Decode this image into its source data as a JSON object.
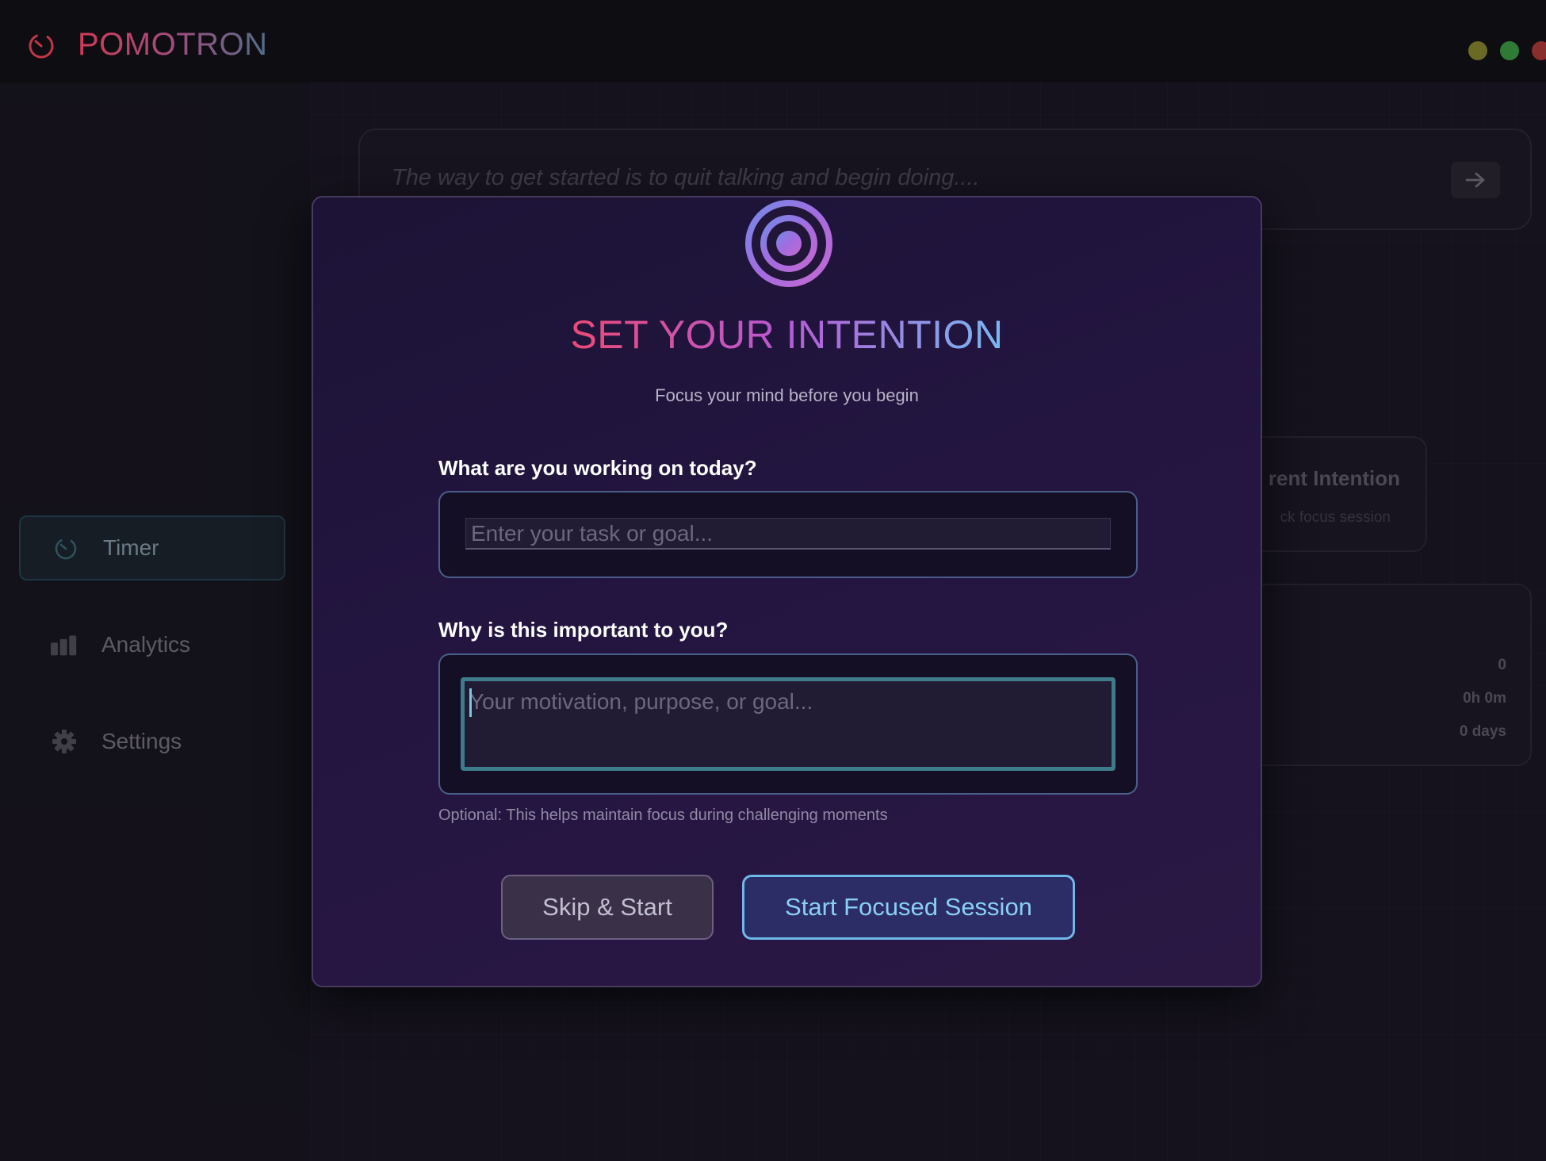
{
  "app": {
    "title": "POMOTRON",
    "logo_icon": "timer-icon",
    "mac_dot_colors": [
      "#3a3a3a",
      "#f4b43a",
      "#4fc94a"
    ],
    "window_dot_colors": [
      "#6b6a24",
      "#2f7a35",
      "#8a2d2d"
    ]
  },
  "sidebar": {
    "items": [
      {
        "label": "Timer",
        "icon": "timer-icon",
        "active": true
      },
      {
        "label": "Analytics",
        "icon": "bar-chart-icon",
        "active": false
      },
      {
        "label": "Settings",
        "icon": "gear-icon",
        "active": false
      }
    ]
  },
  "main": {
    "quote": "The way to get started is to quit talking and begin doing....",
    "quote_action_icon": "arrow-right-icon",
    "intention_card": {
      "title": "rent Intention",
      "subtitle": "ck focus session"
    },
    "stats": [
      "0",
      "0h 0m",
      "0 days"
    ]
  },
  "modal": {
    "icon": "target-icon",
    "title": "SET YOUR INTENTION",
    "subtitle": "Focus your mind before you begin",
    "task": {
      "label": "What are you working on today?",
      "placeholder": "Enter your task or goal...",
      "value": ""
    },
    "motivation": {
      "label": "Why is this important to you?",
      "placeholder": "Your motivation, purpose, or goal...",
      "value": "",
      "hint": "Optional: This helps maintain focus during challenging moments"
    },
    "buttons": {
      "skip": "Skip & Start",
      "start": "Start Focused Session"
    }
  },
  "colors": {
    "accent_pink": "#ec4a78",
    "accent_purple": "#b65ad6",
    "accent_blue": "#78b8f0",
    "focus_ring": "#3e7c8c"
  }
}
